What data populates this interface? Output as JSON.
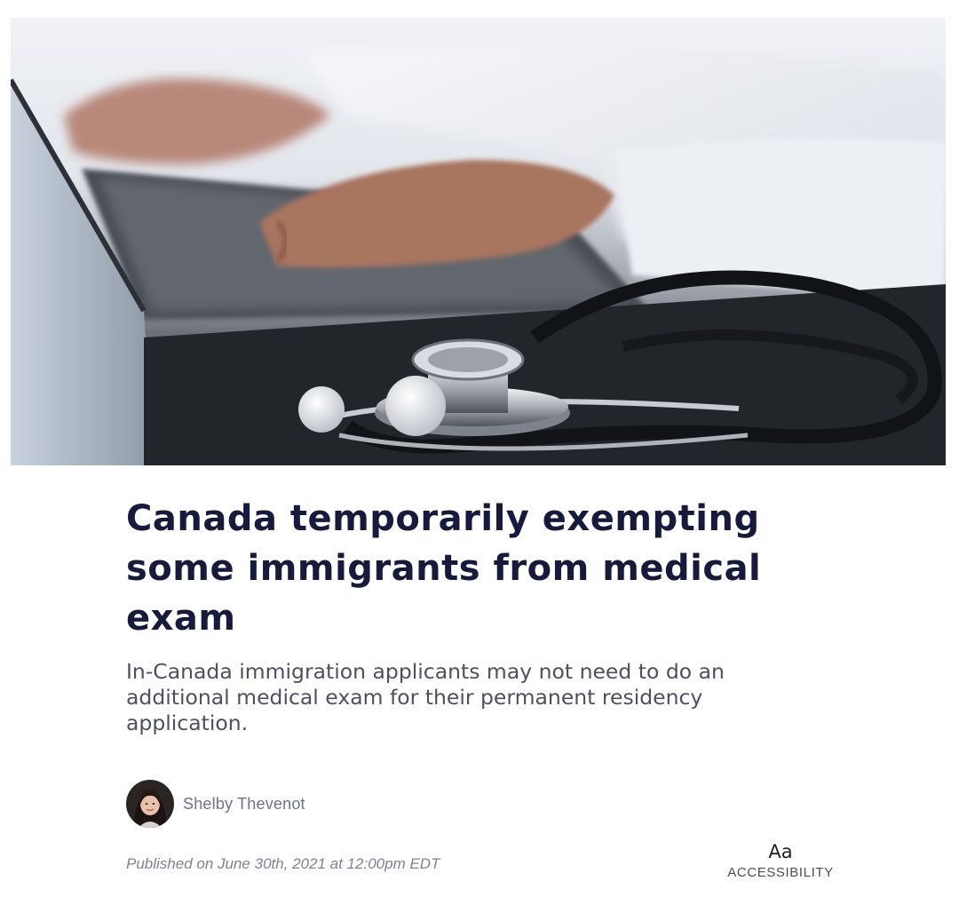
{
  "hero": {
    "image_alt": "Stethoscope lying in front of a person typing on a laptop"
  },
  "article": {
    "headline": "Canada temporarily exempting some immigrants from medical exam",
    "subheadline": "In-Canada immigration applicants may not need to do an additional medical exam for their permanent residency application."
  },
  "author": {
    "name": "Shelby Thevenot"
  },
  "published": "Published on June 30th, 2021 at 12:00pm EDT",
  "accessibility": {
    "icon_text": "Aa",
    "label": "ACCESSIBILITY"
  },
  "colors": {
    "headline": "#161a3d",
    "subheadline": "#4d4f63",
    "author": "#6e7090",
    "meta": "#7f8196"
  },
  "icons": {
    "accessibility": "text-size-icon"
  }
}
